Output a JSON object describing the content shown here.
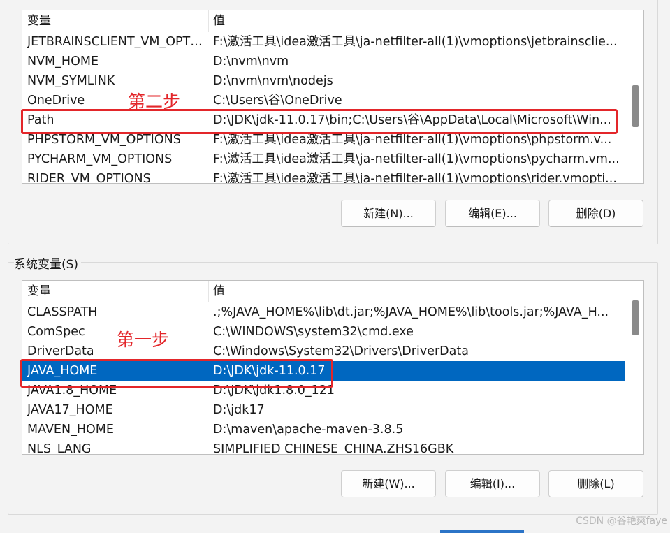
{
  "user_vars": {
    "header": {
      "name": "变量",
      "value": "值"
    },
    "rows": [
      {
        "name": "JETBRAINSCLIENT_VM_OPTI...",
        "value": "F:\\激活工具\\idea激活工具\\ja-netfilter-all(1)\\vmoptions\\jetbrainsclie..."
      },
      {
        "name": "NVM_HOME",
        "value": "D:\\nvm\\nvm"
      },
      {
        "name": "NVM_SYMLINK",
        "value": "D:\\nvm\\nvm\\nodejs"
      },
      {
        "name": "OneDrive",
        "value": "C:\\Users\\谷\\OneDrive"
      },
      {
        "name": "Path",
        "value": "D:\\JDK\\jdk-11.0.17\\bin;C:\\Users\\谷\\AppData\\Local\\Microsoft\\Win..."
      },
      {
        "name": "PHPSTORM_VM_OPTIONS",
        "value": "F:\\激活工具\\idea激活工具\\ja-netfilter-all(1)\\vmoptions\\phpstorm.v..."
      },
      {
        "name": "PYCHARM_VM_OPTIONS",
        "value": "F:\\激活工具\\idea激活工具\\ja-netfilter-all(1)\\vmoptions\\pycharm.vm..."
      },
      {
        "name": "RIDER_VM_OPTIONS",
        "value": "F:\\激活工具\\idea激活工具\\ja-netfilter-all(1)\\vmoptions\\rider.vmopti..."
      }
    ],
    "buttons": {
      "new": "新建(N)...",
      "edit": "编辑(E)...",
      "delete": "删除(D)"
    }
  },
  "system_vars": {
    "title": "系统变量(S)",
    "header": {
      "name": "变量",
      "value": "值"
    },
    "rows": [
      {
        "name": "CLASSPATH",
        "value": ".;%JAVA_HOME%\\lib\\dt.jar;%JAVA_HOME%\\lib\\tools.jar;%JAVA_H..."
      },
      {
        "name": "ComSpec",
        "value": "C:\\WINDOWS\\system32\\cmd.exe"
      },
      {
        "name": "DriverData",
        "value": "C:\\Windows\\System32\\Drivers\\DriverData"
      },
      {
        "name": "JAVA_HOME",
        "value": "D:\\JDK\\jdk-11.0.17"
      },
      {
        "name": "JAVA1.8_HOME",
        "value": "D:\\JDK\\jdk1.8.0_121"
      },
      {
        "name": "JAVA17_HOME",
        "value": "D:\\jdk17"
      },
      {
        "name": "MAVEN_HOME",
        "value": "D:\\maven\\apache-maven-3.8.5"
      },
      {
        "name": "NLS_LANG",
        "value": "SIMPLIFIED CHINESE_CHINA.ZHS16GBK"
      }
    ],
    "selected_row": "JAVA_HOME",
    "buttons": {
      "new": "新建(W)...",
      "edit": "编辑(I)...",
      "delete": "删除(L)"
    }
  },
  "annotations": {
    "step1": "第一步",
    "step2": "第二步",
    "color": "#e3262a"
  },
  "watermark": "CSDN @谷艳爽faye",
  "colors": {
    "selection": "#0067c0",
    "background": "#f3f3f3"
  }
}
